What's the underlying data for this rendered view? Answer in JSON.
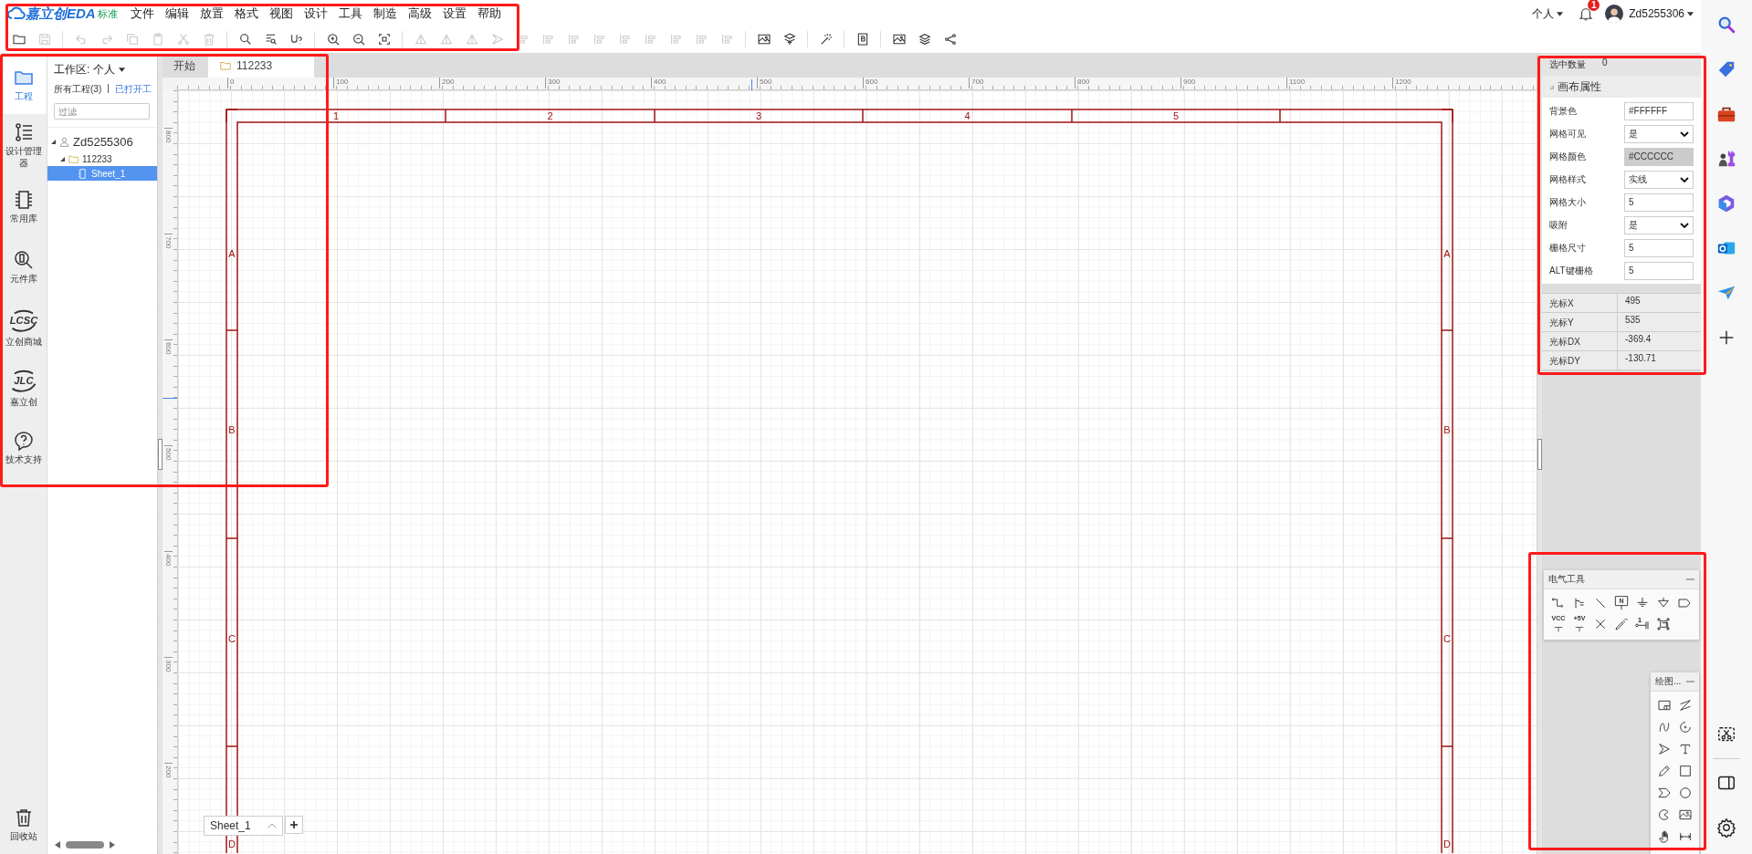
{
  "app": {
    "logo": "嘉立创EDA",
    "edition": "标准"
  },
  "menu": [
    "文件",
    "编辑",
    "放置",
    "格式",
    "视图",
    "设计",
    "工具",
    "制造",
    "高级",
    "设置",
    "帮助"
  ],
  "toolbar": [
    {
      "kind": "folder",
      "disabled": false
    },
    {
      "kind": "save",
      "disabled": true
    },
    {
      "kind": "separator"
    },
    {
      "kind": "undo",
      "disabled": true
    },
    {
      "kind": "redo",
      "disabled": true
    },
    {
      "kind": "copy",
      "disabled": true
    },
    {
      "kind": "paste",
      "disabled": true
    },
    {
      "kind": "scissors",
      "disabled": true
    },
    {
      "kind": "trash",
      "disabled": true
    },
    {
      "kind": "separator"
    },
    {
      "kind": "search",
      "disabled": false
    },
    {
      "kind": "find_list",
      "disabled": false
    },
    {
      "kind": "text_query",
      "disabled": false
    },
    {
      "kind": "separator"
    },
    {
      "kind": "zoom_in",
      "disabled": false
    },
    {
      "kind": "zoom_out",
      "disabled": false
    },
    {
      "kind": "fit",
      "disabled": false
    },
    {
      "kind": "separator"
    },
    {
      "kind": "triangle",
      "disabled": true
    },
    {
      "kind": "triangle",
      "disabled": true
    },
    {
      "kind": "triangle",
      "disabled": true
    },
    {
      "kind": "arrowhead",
      "disabled": true
    },
    {
      "kind": "align",
      "disabled": true
    },
    {
      "kind": "align",
      "disabled": true
    },
    {
      "kind": "align",
      "disabled": true
    },
    {
      "kind": "align",
      "disabled": true
    },
    {
      "kind": "align",
      "disabled": true
    },
    {
      "kind": "align",
      "disabled": true
    },
    {
      "kind": "align",
      "disabled": true
    },
    {
      "kind": "align",
      "disabled": true
    },
    {
      "kind": "align",
      "disabled": true
    },
    {
      "kind": "separator"
    },
    {
      "kind": "picture",
      "disabled": false
    },
    {
      "kind": "layers_up",
      "disabled": false
    },
    {
      "kind": "separator"
    },
    {
      "kind": "wand",
      "disabled": false
    },
    {
      "kind": "separator"
    },
    {
      "kind": "bom",
      "disabled": false
    },
    {
      "kind": "separator"
    },
    {
      "kind": "picture",
      "disabled": false
    },
    {
      "kind": "layers",
      "disabled": false
    },
    {
      "kind": "share",
      "disabled": false
    }
  ],
  "account": {
    "workspace": "个人",
    "notifications": "1",
    "user": "Zd5255306"
  },
  "rail": [
    {
      "kind": "folder",
      "label": "工程",
      "selected": true
    },
    {
      "kind": "design_manager",
      "label": "设计管理器",
      "selected": false
    },
    {
      "kind": "chip",
      "label": "常用库",
      "selected": false
    },
    {
      "kind": "search_chip",
      "label": "元件库",
      "selected": false
    },
    {
      "kind": "lcsc",
      "label": "立创商城",
      "selected": false,
      "logo": "LCSC"
    },
    {
      "kind": "jlc",
      "label": "嘉立创",
      "selected": false,
      "logo": "JLC"
    },
    {
      "kind": "question",
      "label": "技术支持",
      "selected": false
    }
  ],
  "rail_bottom": {
    "label": "回收站"
  },
  "project_panel": {
    "workspace_label": "工作区: 个人",
    "all_projects": "所有工程(3)",
    "divider": "|",
    "opened_link": "已打开工",
    "filter": {
      "placeholder": "过滤"
    },
    "tree": [
      {
        "label": "Zd5255306",
        "kind": "user",
        "expanded": true,
        "selected": false,
        "children": [
          {
            "label": "112233",
            "kind": "folder",
            "expanded": true,
            "selected": false,
            "children": [
              {
                "label": "Sheet_1",
                "kind": "sheet",
                "selected": true
              }
            ]
          }
        ]
      }
    ]
  },
  "tabs": [
    {
      "label": "开始",
      "selected": false
    },
    {
      "label": "112233",
      "selected": true
    }
  ],
  "ruler": {
    "x_labels": [
      "0",
      "100",
      "200",
      "300",
      "400",
      "500",
      "600",
      "700",
      "800",
      "900",
      "1100",
      "1200"
    ],
    "y_labels": [
      "800",
      "700",
      "600",
      "500",
      "400",
      "300",
      "200"
    ]
  },
  "frame": {
    "columns": [
      "1",
      "2",
      "3",
      "4",
      "5"
    ],
    "rows_left": [
      "A",
      "B",
      "C",
      "D"
    ],
    "rows_right": [
      "A",
      "B",
      "C",
      "D"
    ]
  },
  "sheet_tabs": [
    {
      "label": "Sheet_1",
      "selected": true
    }
  ],
  "properties": {
    "selected_count_label": "选中数量",
    "selected_count": "0",
    "section": "画布属性",
    "expanded": true,
    "fields": [
      {
        "kind": "input",
        "label": "背景色",
        "value": "#FFFFFF"
      },
      {
        "kind": "select",
        "label": "网格可见",
        "value": "是"
      },
      {
        "kind": "color",
        "label": "网格颜色",
        "value": "#CCCCCC"
      },
      {
        "kind": "select",
        "label": "网格样式",
        "value": "实线"
      },
      {
        "kind": "input",
        "label": "网格大小",
        "value": "5"
      },
      {
        "kind": "select",
        "label": "吸附",
        "value": "是"
      },
      {
        "kind": "input",
        "label": "栅格尺寸",
        "value": "5"
      },
      {
        "kind": "input",
        "label": "ALT键栅格",
        "value": "5"
      }
    ],
    "cursor": [
      {
        "label": "光标X",
        "value": "495"
      },
      {
        "label": "光标Y",
        "value": "535"
      },
      {
        "label": "光标DX",
        "value": "-369.4"
      },
      {
        "label": "光标DY",
        "value": "-130.71"
      }
    ]
  },
  "electrical_tools": {
    "title": "电气工具",
    "tools": [
      {
        "kind": "wire"
      },
      {
        "kind": "bus"
      },
      {
        "kind": "bus_entry"
      },
      {
        "kind": "net_label",
        "label": "N"
      },
      {
        "kind": "ground"
      },
      {
        "kind": "net_port"
      },
      {
        "kind": "net_flag"
      },
      {
        "kind": "power",
        "label": "VCC"
      },
      {
        "kind": "power",
        "label": "+5V"
      },
      {
        "kind": "no_connect"
      },
      {
        "kind": "probe"
      },
      {
        "kind": "pin",
        "label": "1"
      },
      {
        "kind": "group"
      }
    ]
  },
  "drawing_tools": {
    "title": "绘图...",
    "tools": [
      {
        "kind": "frame"
      },
      {
        "kind": "polyline"
      },
      {
        "kind": "bezier"
      },
      {
        "kind": "arc"
      },
      {
        "kind": "arrowhead"
      },
      {
        "kind": "text"
      },
      {
        "kind": "pencil"
      },
      {
        "kind": "rect"
      },
      {
        "kind": "polygon"
      },
      {
        "kind": "circle"
      },
      {
        "kind": "pie"
      },
      {
        "kind": "image"
      },
      {
        "kind": "hand"
      },
      {
        "kind": "dimension"
      }
    ]
  }
}
